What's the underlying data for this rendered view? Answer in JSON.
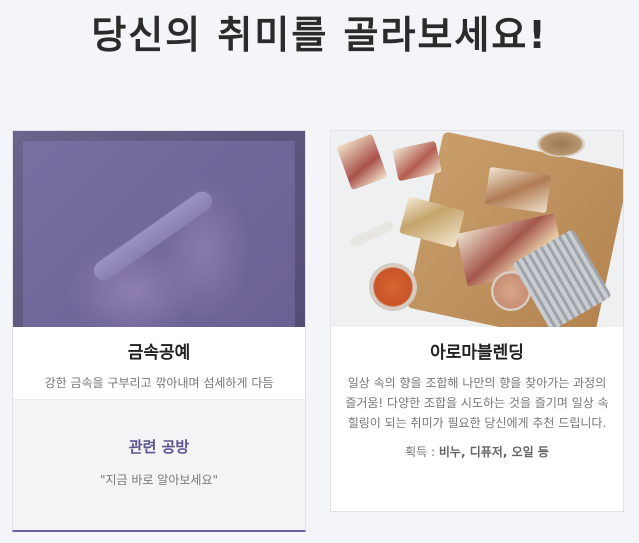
{
  "title": "당신의 취미를 골라보세요!",
  "cards": [
    {
      "name": "금속공예",
      "photo": "metal-craft-photo",
      "description": "강한 금속을 구부리고 깎아내며 섬세하게 다듬",
      "related": {
        "title": "관련 공방",
        "subtitle": "\"지금 바로 알아보세요\""
      },
      "accent": "#6b63a8"
    },
    {
      "name": "아로마블렌딩",
      "photo": "aroma-soap-photo",
      "description": "일상 속의 향을 조합해 나만의 향을 찾아가는 과정의 즐거움! 다양한 조합을 시도하는 것을 즐기며 일상 속 힐링이 되는 취미가 필요한 당신에게 추천 드립니다.",
      "acquire_label": "획득 :",
      "acquire_items": "비누, 디퓨저, 오일 등"
    }
  ]
}
